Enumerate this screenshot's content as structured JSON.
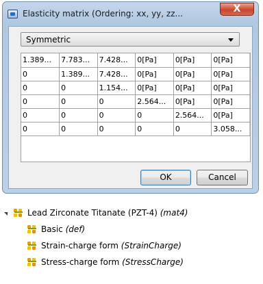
{
  "dialog": {
    "title": "Elasticity matrix (Ordering: xx, yy, zz...",
    "close_glyph": "X",
    "symmetry_select": {
      "value": "Symmetric"
    },
    "matrix": [
      [
        "1.389...",
        "7.783...",
        "7.428...",
        "0[Pa]",
        "0[Pa]",
        "0[Pa]"
      ],
      [
        "0",
        "1.389...",
        "7.428...",
        "0[Pa]",
        "0[Pa]",
        "0[Pa]"
      ],
      [
        "0",
        "0",
        "1.154...",
        "0[Pa]",
        "0[Pa]",
        "0[Pa]"
      ],
      [
        "0",
        "0",
        "0",
        "2.564...",
        "0[Pa]",
        "0[Pa]"
      ],
      [
        "0",
        "0",
        "0",
        "0",
        "2.564...",
        "0[Pa]"
      ],
      [
        "0",
        "0",
        "0",
        "0",
        "0",
        "3.058..."
      ]
    ],
    "ok_label": "OK",
    "cancel_label": "Cancel"
  },
  "tree": {
    "root": {
      "label": "Lead Zirconate Titanate (PZT-4)",
      "tag": "(mat4)",
      "icon": "material-icon"
    },
    "children": [
      {
        "label": "Basic",
        "tag": "(def)",
        "icon": "material-icon"
      },
      {
        "label": "Strain-charge form",
        "tag": "(StrainCharge)",
        "icon": "material-icon"
      },
      {
        "label": "Stress-charge form",
        "tag": "(StressCharge)",
        "icon": "material-icon"
      }
    ]
  }
}
